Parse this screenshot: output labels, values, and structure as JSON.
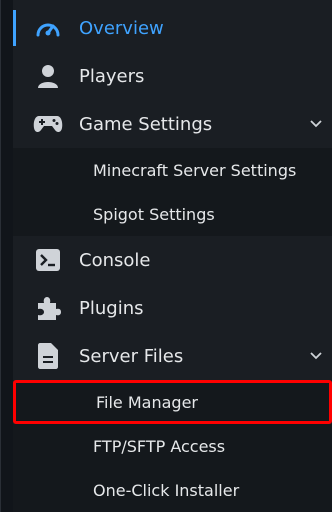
{
  "nav": {
    "overview": "Overview",
    "players": "Players",
    "game_settings": "Game Settings",
    "minecraft_server_settings": "Minecraft Server Settings",
    "spigot_settings": "Spigot Settings",
    "console": "Console",
    "plugins": "Plugins",
    "server_files": "Server Files",
    "file_manager": "File Manager",
    "ftp_sftp_access": "FTP/SFTP Access",
    "one_click_installer": "One-Click Installer"
  },
  "colors": {
    "accent": "#3fa3ff",
    "highlight": "#ff0000"
  },
  "icons": {
    "overview": "speedometer-icon",
    "players": "user-icon",
    "game_settings": "gamepad-icon",
    "console": "terminal-icon",
    "plugins": "puzzle-icon",
    "server_files": "file-icon",
    "chevron": "chevron-down-icon"
  }
}
